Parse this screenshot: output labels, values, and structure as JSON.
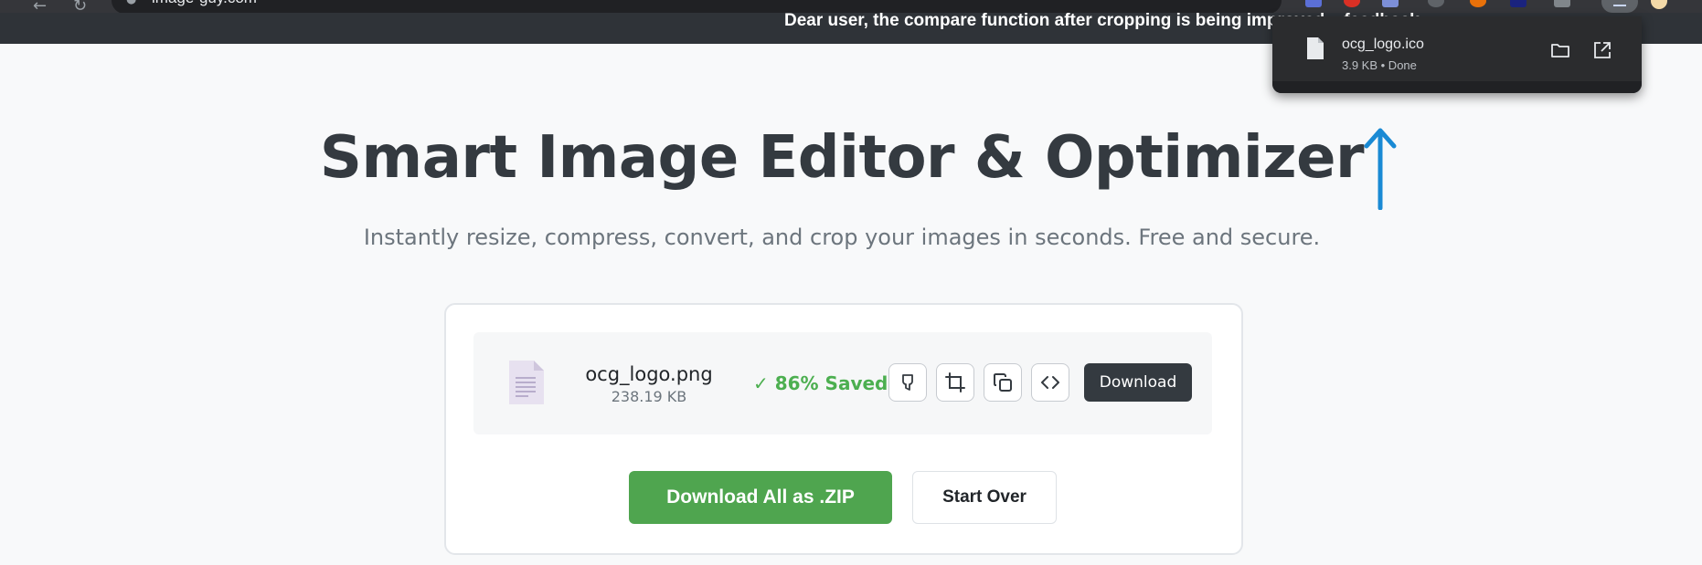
{
  "browser": {
    "url": "image-guy.com",
    "icons": [
      "back-icon",
      "reload-icon",
      "site-info-icon",
      "bookmark-star-icon",
      "downloads-icon",
      "profile-icon"
    ]
  },
  "banner": {
    "text": "Dear user, the compare function after cropping is being improved... feedback."
  },
  "download_popup": {
    "file_name": "ocg_logo.ico",
    "meta": "3.9 KB • Done"
  },
  "hero": {
    "title": "Smart Image Editor & Optimizer",
    "subtitle": "Instantly resize, compress, convert, and crop your images in seconds. Free and secure."
  },
  "file_item": {
    "name": "ocg_logo.png",
    "size": "238.19 KB",
    "saved": "✓ 86% Saved",
    "tools": [
      "color-picker-icon",
      "crop-icon",
      "copy-icon",
      "code-icon"
    ],
    "download_label": "Download"
  },
  "actions": {
    "zip_label": "Download All as .ZIP",
    "start_over_label": "Start Over"
  },
  "colors": {
    "accent_green": "#4fa54f",
    "saved_green": "#4caf50",
    "dark_button": "#343a40",
    "annotation_arrow": "#1a8ad4"
  }
}
